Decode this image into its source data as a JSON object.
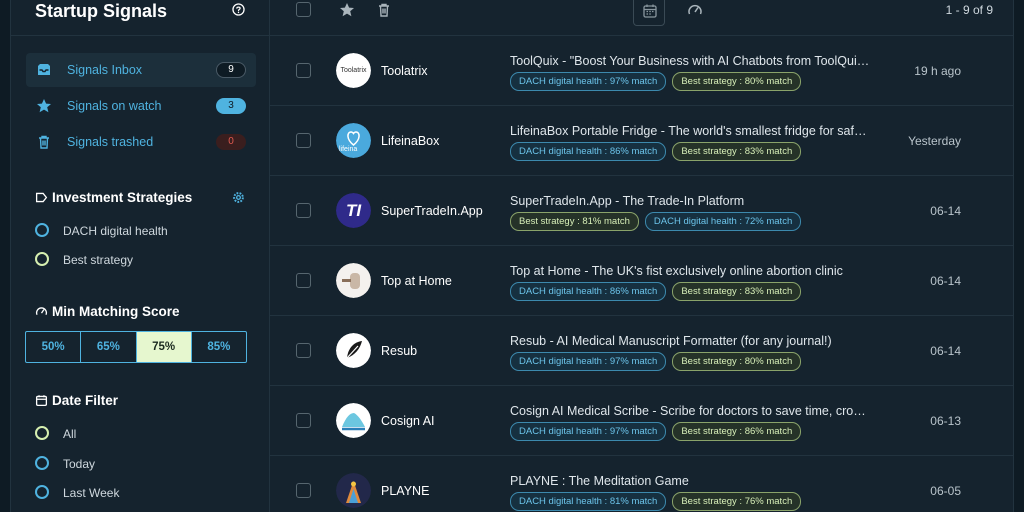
{
  "app": {
    "title": "Startup Signals"
  },
  "nav": [
    {
      "label": "Signals Inbox",
      "count": "9",
      "icon": "inbox-icon"
    },
    {
      "label": "Signals on watch",
      "count": "3",
      "icon": "star-icon"
    },
    {
      "label": "Signals trashed",
      "count": "0",
      "icon": "trash-icon"
    }
  ],
  "strategies": {
    "title": "Investment Strategies",
    "items": [
      {
        "label": "DACH digital health"
      },
      {
        "label": "Best strategy"
      }
    ]
  },
  "score": {
    "title": "Min Matching Score",
    "options": [
      "50%",
      "65%",
      "75%",
      "85%"
    ],
    "selected": "75%"
  },
  "date_filter": {
    "title": "Date Filter",
    "options": [
      "All",
      "Today",
      "Last Week"
    ],
    "selected": "All"
  },
  "pager": {
    "text": "1 - 9 of 9"
  },
  "colors": {
    "accent": "#4fb3e0",
    "lime": "#e6f7cf",
    "bg": "#15232e"
  },
  "signals": [
    {
      "company": "Toolatrix",
      "logo_text": "Toolatrix",
      "headline": "ToolQuix - \"Boost Your Business with AI Chatbots from ToolQuix!\"",
      "tags": [
        {
          "text": "DACH digital health : 97% match",
          "kind": "blue"
        },
        {
          "text": "Best strategy : 80% match",
          "kind": "green"
        }
      ],
      "date": "19 h ago"
    },
    {
      "company": "LifeinaBox",
      "logo_text": "lifeina",
      "headline": "LifeinaBox Portable Fridge - The world's smallest fridge for safe storage",
      "tags": [
        {
          "text": "DACH digital health : 86% match",
          "kind": "blue"
        },
        {
          "text": "Best strategy : 83% match",
          "kind": "green"
        }
      ],
      "date": "Yesterday"
    },
    {
      "company": "SuperTradeIn.App",
      "logo_text": "TI",
      "headline": "SuperTradeIn.App - The Trade-In Platform",
      "tags": [
        {
          "text": "Best strategy : 81% match",
          "kind": "green"
        },
        {
          "text": "DACH digital health : 72% match",
          "kind": "blue"
        }
      ],
      "date": "06-14"
    },
    {
      "company": "Top at Home",
      "logo_text": "",
      "headline": "Top at Home - The UK's fist exclusively online abortion clinic",
      "tags": [
        {
          "text": "DACH digital health : 86% match",
          "kind": "blue"
        },
        {
          "text": "Best strategy : 83% match",
          "kind": "green"
        }
      ],
      "date": "06-14"
    },
    {
      "company": "Resub",
      "logo_text": "",
      "headline": "Resub - AI Medical Manuscript Formatter (for any journal!)",
      "tags": [
        {
          "text": "DACH digital health : 97% match",
          "kind": "blue"
        },
        {
          "text": "Best strategy : 80% match",
          "kind": "green"
        }
      ],
      "date": "06-14"
    },
    {
      "company": "Cosign AI",
      "logo_text": "",
      "headline": "Cosign AI Medical Scribe - Scribe for doctors to save time, cross-check notes",
      "tags": [
        {
          "text": "DACH digital health : 97% match",
          "kind": "blue"
        },
        {
          "text": "Best strategy : 86% match",
          "kind": "green"
        }
      ],
      "date": "06-13"
    },
    {
      "company": "PLAYNE",
      "logo_text": "",
      "headline": "PLAYNE : The Meditation Game",
      "tags": [
        {
          "text": "DACH digital health : 81% match",
          "kind": "blue"
        },
        {
          "text": "Best strategy : 76% match",
          "kind": "green"
        }
      ],
      "date": "06-05"
    }
  ]
}
